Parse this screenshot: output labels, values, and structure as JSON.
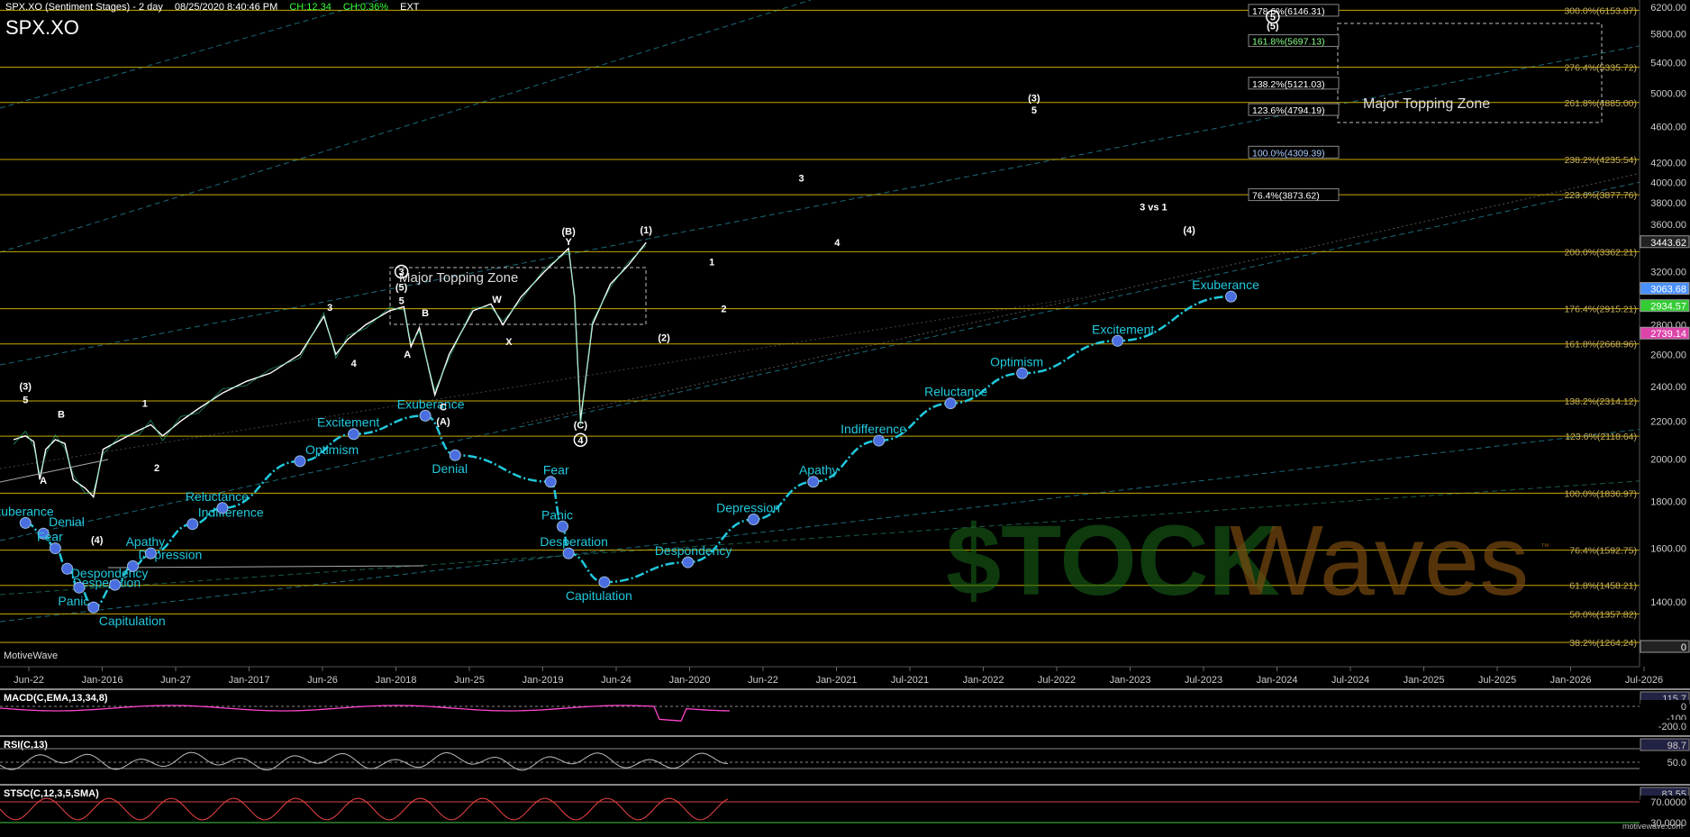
{
  "header": {
    "title": "SPX.XO (Sentiment Stages) - 2 day",
    "datetime": "08/25/2020 8:40:46 PM",
    "change_high": "CH:12.34",
    "change_pct": "CH:0.36%",
    "ext": "EXT",
    "symbol": "SPX.XO"
  },
  "branding": {
    "left": "MotiveWave",
    "right": "motivewave.com",
    "watermark_left": "$TOCK",
    "watermark_right": "Waves",
    "tm": "™"
  },
  "colors": {
    "background": "#000000",
    "sentiment": "#22c8dc",
    "fib_line": "#c8a800",
    "price": "#ffffff",
    "watermark": "#7a4a10",
    "watermark_green": "#1a6a1a"
  },
  "chart_data": [
    {
      "type": "line",
      "title": "SPX.XO (Sentiment Stages) - 2 day",
      "ylim": [
        1200,
        6400
      ],
      "y_ticks": [
        "6200.00",
        "5800.00",
        "5400.00",
        "5000.00",
        "4600.00",
        "4200.00",
        "4000.00",
        "3800.00",
        "3600.00",
        "3200.00",
        "2800.00",
        "2600.00",
        "2400.00",
        "2200.00",
        "2000.00",
        "1800.00",
        "1600.00",
        "1400.00"
      ],
      "x_ticks": [
        "Jun-22",
        "Jan-2016",
        "Jun-27",
        "Jan-2017",
        "Jun-26",
        "Jan-2018",
        "Jun-25",
        "Jan-2019",
        "Jun-24",
        "Jan-2020",
        "Jun-22",
        "Jan-2021",
        "Jul-2021",
        "Jan-2022",
        "Jul-2022",
        "Jan-2023",
        "Jul-2023",
        "Jan-2024",
        "Jul-2024",
        "Jan-2025",
        "Jul-2025",
        "Jan-2026",
        "Jul-2026"
      ],
      "price_badges": [
        {
          "label": "3443.62",
          "value": 3443.62,
          "color": "#ffffff"
        },
        {
          "label": "3063.68",
          "value": 3063.68,
          "color": "#4a90ff"
        },
        {
          "label": "2934.57",
          "value": 2934.57,
          "color": "#33cc33"
        },
        {
          "label": "2739.14",
          "value": 2739.14,
          "color": "#dd44aa"
        },
        {
          "label": "0",
          "value": 1250,
          "color": "#ffffff"
        }
      ],
      "fib_levels_right": [
        {
          "label": "300.0%(6153.87)",
          "value": 6153.87
        },
        {
          "label": "276.4%(5335.72)",
          "value": 5335.72
        },
        {
          "label": "261.8%(4885.00)",
          "value": 4885.0
        },
        {
          "label": "238.2%(4235.54)",
          "value": 4235.54
        },
        {
          "label": "223.6%(3877.76)",
          "value": 3877.76
        },
        {
          "label": "200.0%(3362.21)",
          "value": 3362.21
        },
        {
          "label": "176.4%(2915.21)",
          "value": 2915.21
        },
        {
          "label": "161.8%(2668.96)",
          "value": 2668.96
        },
        {
          "label": "138.2%(2314.12)",
          "value": 2314.12
        },
        {
          "label": "123.6%(2118.64)",
          "value": 2118.64
        },
        {
          "label": "100.0%(1836.97)",
          "value": 1836.97
        },
        {
          "label": "76.4%(1592.75)",
          "value": 1592.75
        },
        {
          "label": "61.8%(1458.21)",
          "value": 1458.21
        },
        {
          "label": "50.0%(1357.82)",
          "value": 1357.82
        },
        {
          "label": "38.2%(1264.24)",
          "value": 1264.24
        }
      ],
      "fib_levels_box": [
        {
          "label": "178.6%(6146.31)",
          "value": 6146.31,
          "color": "#ffffff"
        },
        {
          "label": "161.8%(5697.13)",
          "value": 5697.13,
          "color": "#88ff88"
        },
        {
          "label": "138.2%(5121.03)",
          "value": 5121.03,
          "color": "#ffffff"
        },
        {
          "label": "123.6%(4794.19)",
          "value": 4794.19,
          "color": "#ffffff"
        },
        {
          "label": "100.0%(4309.39)",
          "value": 4309.39,
          "color": "#aaccff"
        },
        {
          "label": "76.4%(3873.62)",
          "value": 3873.62,
          "color": "#ffffff"
        }
      ],
      "zones": [
        "Major Topping Zone",
        "Major Topping Zone"
      ],
      "sentiment_series": [
        {
          "label": "Exuberance",
          "year": 2015.55,
          "value": 1705
        },
        {
          "label": "Denial",
          "year": 2015.7,
          "value": 1660
        },
        {
          "label": "Fear",
          "year": 2015.8,
          "value": 1600
        },
        {
          "label": "Desperation",
          "year": 2015.9,
          "value": 1520
        },
        {
          "label": "Panic",
          "year": 2016.0,
          "value": 1450
        },
        {
          "label": "Capitulation",
          "year": 2016.12,
          "value": 1380
        },
        {
          "label": "Despondency",
          "year": 2016.3,
          "value": 1460
        },
        {
          "label": "Depression",
          "year": 2016.45,
          "value": 1530
        },
        {
          "label": "Apathy",
          "year": 2016.6,
          "value": 1580
        },
        {
          "label": "Indifference",
          "year": 2016.95,
          "value": 1700
        },
        {
          "label": "Reluctance",
          "year": 2017.2,
          "value": 1770
        },
        {
          "label": "Optimism",
          "year": 2017.85,
          "value": 1990
        },
        {
          "label": "Excitement",
          "year": 2018.3,
          "value": 2130
        },
        {
          "label": "Exuberance",
          "year": 2018.9,
          "value": 2230
        },
        {
          "label": "Denial",
          "year": 2019.15,
          "value": 2020
        },
        {
          "label": "Fear",
          "year": 2019.95,
          "value": 1890
        },
        {
          "label": "Panic",
          "year": 2020.05,
          "value": 1690
        },
        {
          "label": "Desperation",
          "year": 2020.1,
          "value": 1580
        },
        {
          "label": "Capitulation",
          "year": 2020.4,
          "value": 1470
        },
        {
          "label": "Despondency",
          "year": 2021.1,
          "value": 1545
        },
        {
          "label": "Depression",
          "year": 2021.65,
          "value": 1720
        },
        {
          "label": "Apathy",
          "year": 2022.15,
          "value": 1890
        },
        {
          "label": "Indifference",
          "year": 2022.7,
          "value": 2095
        },
        {
          "label": "Reluctance",
          "year": 2023.3,
          "value": 2300
        },
        {
          "label": "Optimism",
          "year": 2023.9,
          "value": 2480
        },
        {
          "label": "Excitement",
          "year": 2024.7,
          "value": 2690
        },
        {
          "label": "Exuberance",
          "year": 2025.65,
          "value": 3005
        }
      ],
      "wave_labels": [
        {
          "text": "(3)",
          "year": 2015.55,
          "value": 2380
        },
        {
          "text": "5",
          "year": 2015.55,
          "value": 2300
        },
        {
          "text": "B",
          "year": 2015.85,
          "value": 2220
        },
        {
          "text": "A",
          "year": 2015.7,
          "value": 1880
        },
        {
          "text": "(4)",
          "year": 2016.15,
          "value": 1620
        },
        {
          "text": "1",
          "year": 2016.55,
          "value": 2280
        },
        {
          "text": "2",
          "year": 2016.65,
          "value": 1940
        },
        {
          "text": "3",
          "year": 2018.1,
          "value": 2900
        },
        {
          "text": "4",
          "year": 2018.3,
          "value": 2520
        },
        {
          "text": "(5)",
          "year": 2018.7,
          "value": 3050
        },
        {
          "text": "5",
          "year": 2018.7,
          "value": 2950
        },
        {
          "text": "A",
          "year": 2018.75,
          "value": 2580
        },
        {
          "text": "B",
          "year": 2018.9,
          "value": 2860
        },
        {
          "text": "C",
          "year": 2019.05,
          "value": 2260
        },
        {
          "text": "(A)",
          "year": 2019.05,
          "value": 2180
        },
        {
          "text": "W",
          "year": 2019.5,
          "value": 2960
        },
        {
          "text": "X",
          "year": 2019.6,
          "value": 2660
        },
        {
          "text": "(B)",
          "year": 2020.1,
          "value": 3510
        },
        {
          "text": "Y",
          "year": 2020.1,
          "value": 3420
        },
        {
          "text": "(C)",
          "year": 2020.2,
          "value": 2160
        },
        {
          "text": "(1)",
          "year": 2020.75,
          "value": 3520
        },
        {
          "text": "(2)",
          "year": 2020.9,
          "value": 2690
        },
        {
          "text": "1",
          "year": 2021.3,
          "value": 3250
        },
        {
          "text": "2",
          "year": 2021.4,
          "value": 2890
        },
        {
          "text": "4",
          "year": 2022.35,
          "value": 3410
        },
        {
          "text": "3",
          "year": 2022.05,
          "value": 4010
        },
        {
          "text": "(3)",
          "year": 2024.0,
          "value": 4900
        },
        {
          "text": "5",
          "year": 2024.0,
          "value": 4750
        },
        {
          "text": "3 vs 1",
          "year": 2025.0,
          "value": 3730
        },
        {
          "text": "(4)",
          "year": 2025.3,
          "value": 3520
        },
        {
          "text": "(5)",
          "year": 2026.0,
          "value": 5870
        }
      ],
      "circled_labels": [
        {
          "text": "5",
          "year": 2026.0,
          "value": 6000
        },
        {
          "text": "4",
          "year": 2020.2,
          "value": 2080
        },
        {
          "text": "3",
          "year": 2018.7,
          "value": 3170
        }
      ]
    },
    {
      "type": "line",
      "title": "MACD(C,EMA,13,34,8)",
      "ticks": [
        "115.7",
        "0",
        "-100",
        "-200.0"
      ]
    },
    {
      "type": "line",
      "title": "RSI(C,13)",
      "ticks": [
        "98.7",
        "50.0"
      ]
    },
    {
      "type": "line",
      "title": "STSC(C,12,3,5,SMA)",
      "ticks": [
        "83.55",
        "70.0000",
        "30.0000"
      ]
    }
  ]
}
